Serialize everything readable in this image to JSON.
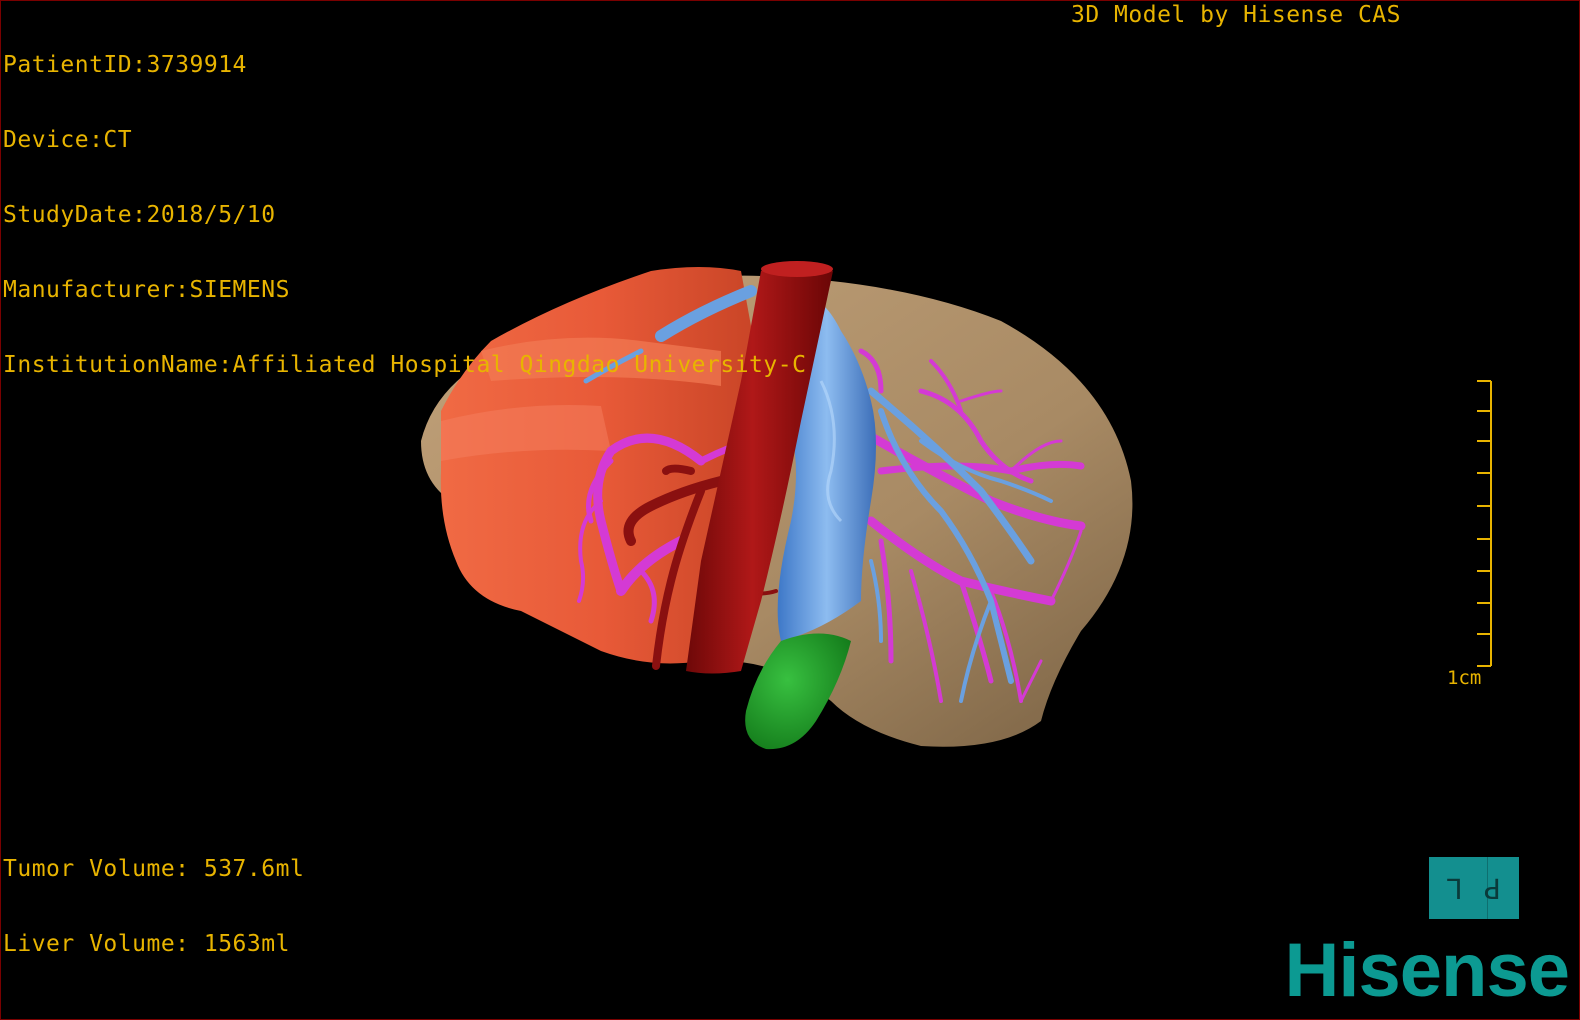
{
  "study": {
    "patient_id": "PatientID:3739914",
    "device": "Device:CT",
    "study_date": "StudyDate:2018/5/10",
    "manufacturer": "Manufacturer:SIEMENS",
    "institution": "InstitutionName:Affiliated Hospital Qingdao University-C"
  },
  "header": {
    "model_credit": "3D Model by Hisense CAS"
  },
  "volumes": {
    "tumor": "Tumor Volume: 537.6ml",
    "liver": "Liver Volume: 1563ml"
  },
  "scale_bar": {
    "label": "1cm"
  },
  "orientation_cube": {
    "left_glyph": "L",
    "right_glyph": "P"
  },
  "brand": {
    "name": "Hisense"
  },
  "colors": {
    "overlay_text": "#e8b400",
    "liver": "#a88a64",
    "tumor": "#e85a38",
    "artery": "#9a0f0f",
    "portal_vein": "#d43ad4",
    "hepatic_vein": "#6aa0e0",
    "gallbladder": "#1e9c28",
    "brand": "#0c9a92"
  }
}
